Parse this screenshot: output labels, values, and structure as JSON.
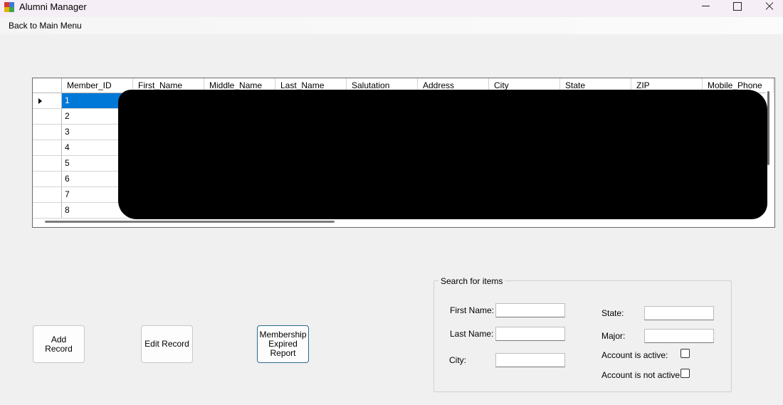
{
  "window": {
    "title": "Alumni Manager",
    "icon": "app-window-icon"
  },
  "menu": {
    "back_label": "Back to Main Menu"
  },
  "grid": {
    "columns": [
      "Member_ID",
      "First_Name",
      "Middle_Name",
      "Last_Name",
      "Salutation",
      "Address",
      "City",
      "State",
      "ZIP",
      "Mobile_Phone"
    ],
    "rows": [
      "1",
      "2",
      "3",
      "4",
      "5",
      "6",
      "7",
      "8"
    ],
    "selected_row": 1,
    "selection_color": "#0078d7"
  },
  "buttons": {
    "add_label": "Add Record",
    "edit_label": "Edit Record",
    "report_label": "Membership Expired Report"
  },
  "search": {
    "group_title": "Search for items",
    "first_name_label": "First Name:",
    "last_name_label": "Last Name:",
    "city_label": "City:",
    "state_label": "State:",
    "major_label": "Major:",
    "active_label": "Account is active:",
    "not_active_label": "Account is not active",
    "first_name_value": "",
    "last_name_value": "",
    "city_value": "",
    "state_value": "",
    "major_value": "",
    "active_checked": false,
    "not_active_checked": false
  }
}
